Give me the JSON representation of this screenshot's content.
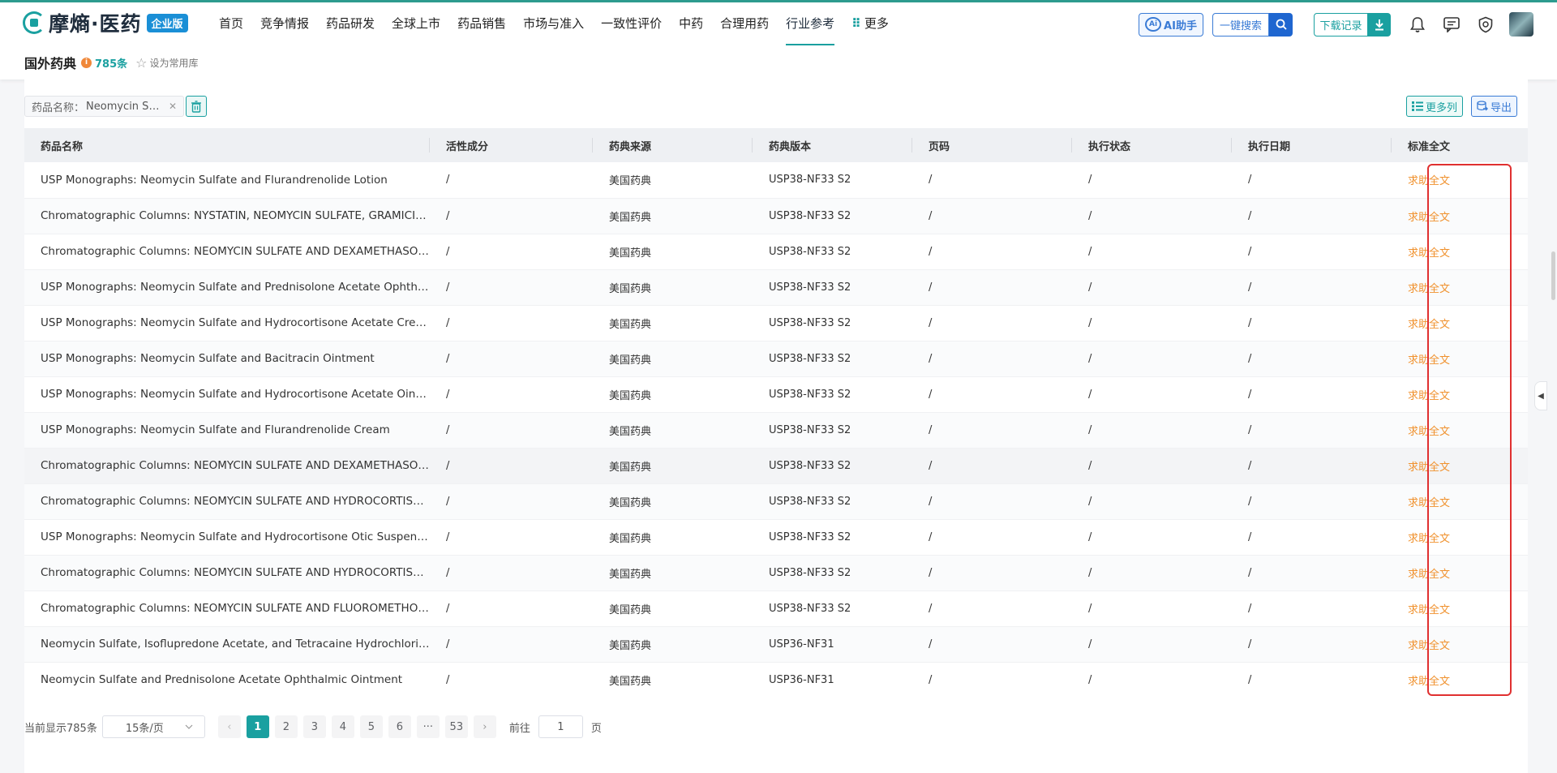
{
  "brand": {
    "name": "摩熵·医药",
    "badge": "企业版"
  },
  "nav": [
    {
      "label": "首页"
    },
    {
      "label": "竞争情报"
    },
    {
      "label": "药品研发"
    },
    {
      "label": "全球上市"
    },
    {
      "label": "药品销售"
    },
    {
      "label": "市场与准入"
    },
    {
      "label": "一致性评价"
    },
    {
      "label": "中药"
    },
    {
      "label": "合理用药"
    },
    {
      "label": "行业参考",
      "active": true
    },
    {
      "label": "更多"
    }
  ],
  "header_tools": {
    "ai_label": "AI助手",
    "search_label": "一键搜索",
    "download_label": "下载记录"
  },
  "page": {
    "title": "国外药典",
    "info": "i",
    "count": "785条",
    "favorite_label": "设为常用库"
  },
  "filter": {
    "chip_label": "药品名称：",
    "chip_value": "Neomycin Sulfate",
    "more_columns": "更多列",
    "export": "导出"
  },
  "table": {
    "columns": [
      "药品名称",
      "活性成分",
      "药典来源",
      "药典版本",
      "页码",
      "执行状态",
      "执行日期",
      "标准全文"
    ],
    "rows": [
      {
        "name": "USP Monographs: Neomycin Sulfate and Flurandrenolide Lotion",
        "ingredient": "/",
        "source": "美国药典",
        "version": "USP38-NF33 S2",
        "page": "/",
        "status": "/",
        "date": "/",
        "fulltext": "求助全文"
      },
      {
        "name": "Chromatographic Columns: NYSTATIN, NEOMYCIN SULFATE, GRAMICIDIN, AND TRIAMCINOLONE",
        "ingredient": "/",
        "source": "美国药典",
        "version": "USP38-NF33 S2",
        "page": "/",
        "status": "/",
        "date": "/",
        "fulltext": "求助全文"
      },
      {
        "name": "Chromatographic Columns: NEOMYCIN SULFATE AND DEXAMETHASONE SODIUM PHOSPHATE",
        "ingredient": "/",
        "source": "美国药典",
        "version": "USP38-NF33 S2",
        "page": "/",
        "status": "/",
        "date": "/",
        "fulltext": "求助全文"
      },
      {
        "name": "USP Monographs: Neomycin Sulfate and Prednisolone Acetate Ophthalmic Suspension",
        "ingredient": "/",
        "source": "美国药典",
        "version": "USP38-NF33 S2",
        "page": "/",
        "status": "/",
        "date": "/",
        "fulltext": "求助全文"
      },
      {
        "name": "USP Monographs: Neomycin Sulfate and Hydrocortisone Acetate Cream",
        "ingredient": "/",
        "source": "美国药典",
        "version": "USP38-NF33 S2",
        "page": "/",
        "status": "/",
        "date": "/",
        "fulltext": "求助全文"
      },
      {
        "name": "USP Monographs: Neomycin Sulfate and Bacitracin Ointment",
        "ingredient": "/",
        "source": "美国药典",
        "version": "USP38-NF33 S2",
        "page": "/",
        "status": "/",
        "date": "/",
        "fulltext": "求助全文"
      },
      {
        "name": "USP Monographs: Neomycin Sulfate and Hydrocortisone Acetate Ointment",
        "ingredient": "/",
        "source": "美国药典",
        "version": "USP38-NF33 S2",
        "page": "/",
        "status": "/",
        "date": "/",
        "fulltext": "求助全文"
      },
      {
        "name": "USP Monographs: Neomycin Sulfate and Flurandrenolide Cream",
        "ingredient": "/",
        "source": "美国药典",
        "version": "USP38-NF33 S2",
        "page": "/",
        "status": "/",
        "date": "/",
        "fulltext": "求助全文"
      },
      {
        "name": "Chromatographic Columns: NEOMYCIN SULFATE AND DEXAMETHASONE SODIUM PHOSPHATE",
        "ingredient": "/",
        "source": "美国药典",
        "version": "USP38-NF33 S2",
        "page": "/",
        "status": "/",
        "date": "/",
        "fulltext": "求助全文"
      },
      {
        "name": "Chromatographic Columns: NEOMYCIN SULFATE AND HYDROCORTISONE ACETATE",
        "ingredient": "/",
        "source": "美国药典",
        "version": "USP38-NF33 S2",
        "page": "/",
        "status": "/",
        "date": "/",
        "fulltext": "求助全文"
      },
      {
        "name": "USP Monographs: Neomycin Sulfate and Hydrocortisone Otic Suspension",
        "ingredient": "/",
        "source": "美国药典",
        "version": "USP38-NF33 S2",
        "page": "/",
        "status": "/",
        "date": "/",
        "fulltext": "求助全文"
      },
      {
        "name": "Chromatographic Columns: NEOMYCIN SULFATE AND HYDROCORTISONE ACETATE",
        "ingredient": "/",
        "source": "美国药典",
        "version": "USP38-NF33 S2",
        "page": "/",
        "status": "/",
        "date": "/",
        "fulltext": "求助全文"
      },
      {
        "name": "Chromatographic Columns: NEOMYCIN SULFATE AND FLUOROMETHOLONE OINTMENT",
        "ingredient": "/",
        "source": "美国药典",
        "version": "USP38-NF33 S2",
        "page": "/",
        "status": "/",
        "date": "/",
        "fulltext": "求助全文"
      },
      {
        "name": "Neomycin Sulfate, Isoflupredone Acetate, and Tetracaine Hydrochloride Ointment",
        "ingredient": "/",
        "source": "美国药典",
        "version": "USP36-NF31",
        "page": "/",
        "status": "/",
        "date": "/",
        "fulltext": "求助全文"
      },
      {
        "name": "Neomycin Sulfate and Prednisolone Acetate Ophthalmic Ointment",
        "ingredient": "/",
        "source": "美国药典",
        "version": "USP36-NF31",
        "page": "/",
        "status": "/",
        "date": "/",
        "fulltext": "求助全文"
      }
    ]
  },
  "pagination": {
    "total_text": "当前显示785条",
    "page_size": "15条/页",
    "prev": "‹",
    "pages": [
      "1",
      "2",
      "3",
      "4",
      "5",
      "6",
      "···",
      "53"
    ],
    "current": "1",
    "next": "›",
    "goto_label": "前往",
    "goto_value": "1",
    "goto_suffix": "页"
  },
  "colors": {
    "accent": "#1aa0a0",
    "link_orange": "#f0912d",
    "highlight_red": "#e03030",
    "blue": "#3a7bd5"
  }
}
